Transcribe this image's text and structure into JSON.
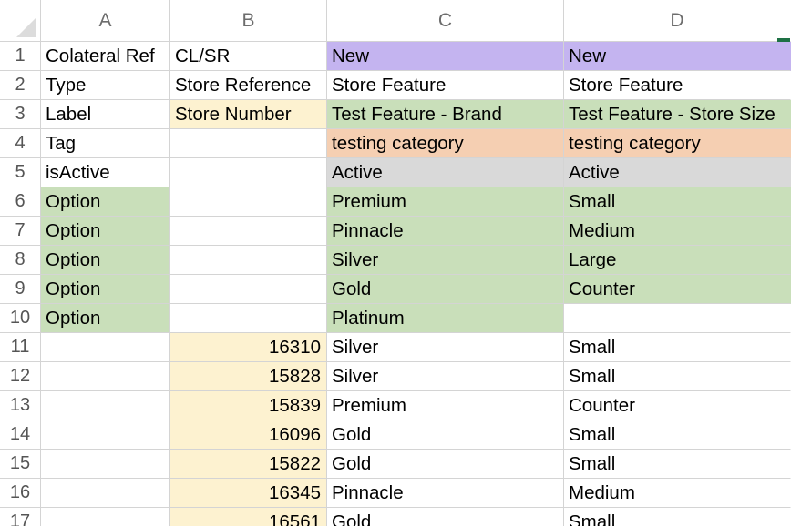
{
  "columns": [
    "A",
    "B",
    "C",
    "D"
  ],
  "rows": [
    {
      "n": "1",
      "cells": [
        {
          "v": "Colateral Ref",
          "bg": "#ffffff"
        },
        {
          "v": "CL/SR",
          "bg": "#ffffff"
        },
        {
          "v": "New",
          "bg": "#c4b4f0"
        },
        {
          "v": "New",
          "bg": "#c4b4f0"
        }
      ]
    },
    {
      "n": "2",
      "cells": [
        {
          "v": "Type",
          "bg": "#ffffff"
        },
        {
          "v": "Store Reference",
          "bg": "#ffffff"
        },
        {
          "v": "Store Feature",
          "bg": "#ffffff"
        },
        {
          "v": "Store Feature",
          "bg": "#ffffff"
        }
      ]
    },
    {
      "n": "3",
      "cells": [
        {
          "v": "Label",
          "bg": "#ffffff"
        },
        {
          "v": "Store Number",
          "bg": "#fdf2d0"
        },
        {
          "v": "Test Feature - Brand",
          "bg": "#c9dfba"
        },
        {
          "v": "Test Feature - Store Size",
          "bg": "#c9dfba"
        }
      ]
    },
    {
      "n": "4",
      "cells": [
        {
          "v": "Tag",
          "bg": "#ffffff"
        },
        {
          "v": "",
          "bg": "#ffffff"
        },
        {
          "v": "testing category",
          "bg": "#f5cfb2"
        },
        {
          "v": "testing category",
          "bg": "#f5cfb2"
        }
      ]
    },
    {
      "n": "5",
      "cells": [
        {
          "v": "isActive",
          "bg": "#ffffff"
        },
        {
          "v": "",
          "bg": "#ffffff"
        },
        {
          "v": "Active",
          "bg": "#d9d9d9"
        },
        {
          "v": "Active",
          "bg": "#d9d9d9"
        }
      ]
    },
    {
      "n": "6",
      "cells": [
        {
          "v": "Option",
          "bg": "#c9dfba"
        },
        {
          "v": "",
          "bg": "#ffffff"
        },
        {
          "v": "Premium",
          "bg": "#c9dfba"
        },
        {
          "v": "Small",
          "bg": "#c9dfba"
        }
      ]
    },
    {
      "n": "7",
      "cells": [
        {
          "v": "Option",
          "bg": "#c9dfba"
        },
        {
          "v": "",
          "bg": "#ffffff"
        },
        {
          "v": "Pinnacle",
          "bg": "#c9dfba"
        },
        {
          "v": "Medium",
          "bg": "#c9dfba"
        }
      ]
    },
    {
      "n": "8",
      "cells": [
        {
          "v": "Option",
          "bg": "#c9dfba"
        },
        {
          "v": "",
          "bg": "#ffffff"
        },
        {
          "v": "Silver",
          "bg": "#c9dfba"
        },
        {
          "v": "Large",
          "bg": "#c9dfba"
        }
      ]
    },
    {
      "n": "9",
      "cells": [
        {
          "v": "Option",
          "bg": "#c9dfba"
        },
        {
          "v": "",
          "bg": "#ffffff"
        },
        {
          "v": "Gold",
          "bg": "#c9dfba"
        },
        {
          "v": "Counter",
          "bg": "#c9dfba"
        }
      ]
    },
    {
      "n": "10",
      "cells": [
        {
          "v": "Option",
          "bg": "#c9dfba"
        },
        {
          "v": "",
          "bg": "#ffffff"
        },
        {
          "v": "Platinum",
          "bg": "#c9dfba"
        },
        {
          "v": "",
          "bg": "#ffffff"
        }
      ]
    },
    {
      "n": "11",
      "cells": [
        {
          "v": "",
          "bg": "#ffffff"
        },
        {
          "v": "16310",
          "bg": "#fdf2d0",
          "num": true
        },
        {
          "v": "Silver",
          "bg": "#ffffff"
        },
        {
          "v": "Small",
          "bg": "#ffffff"
        }
      ]
    },
    {
      "n": "12",
      "cells": [
        {
          "v": "",
          "bg": "#ffffff"
        },
        {
          "v": "15828",
          "bg": "#fdf2d0",
          "num": true
        },
        {
          "v": "Silver",
          "bg": "#ffffff"
        },
        {
          "v": "Small",
          "bg": "#ffffff"
        }
      ]
    },
    {
      "n": "13",
      "cells": [
        {
          "v": "",
          "bg": "#ffffff"
        },
        {
          "v": "15839",
          "bg": "#fdf2d0",
          "num": true
        },
        {
          "v": "Premium",
          "bg": "#ffffff"
        },
        {
          "v": "Counter",
          "bg": "#ffffff"
        }
      ]
    },
    {
      "n": "14",
      "cells": [
        {
          "v": "",
          "bg": "#ffffff"
        },
        {
          "v": "16096",
          "bg": "#fdf2d0",
          "num": true
        },
        {
          "v": "Gold",
          "bg": "#ffffff"
        },
        {
          "v": "Small",
          "bg": "#ffffff"
        }
      ]
    },
    {
      "n": "15",
      "cells": [
        {
          "v": "",
          "bg": "#ffffff"
        },
        {
          "v": "15822",
          "bg": "#fdf2d0",
          "num": true
        },
        {
          "v": "Gold",
          "bg": "#ffffff"
        },
        {
          "v": "Small",
          "bg": "#ffffff"
        }
      ]
    },
    {
      "n": "16",
      "cells": [
        {
          "v": "",
          "bg": "#ffffff"
        },
        {
          "v": "16345",
          "bg": "#fdf2d0",
          "num": true
        },
        {
          "v": "Pinnacle",
          "bg": "#ffffff"
        },
        {
          "v": "Medium",
          "bg": "#ffffff"
        }
      ]
    },
    {
      "n": "17",
      "cells": [
        {
          "v": "",
          "bg": "#ffffff"
        },
        {
          "v": "16561",
          "bg": "#fdf2d0",
          "num": true
        },
        {
          "v": "Gold",
          "bg": "#ffffff"
        },
        {
          "v": "Small",
          "bg": "#ffffff"
        }
      ]
    }
  ],
  "colors": {
    "gridline": "#d4d4d4",
    "header_text": "#6d6d6d",
    "selection_accent": "#1e7145"
  }
}
